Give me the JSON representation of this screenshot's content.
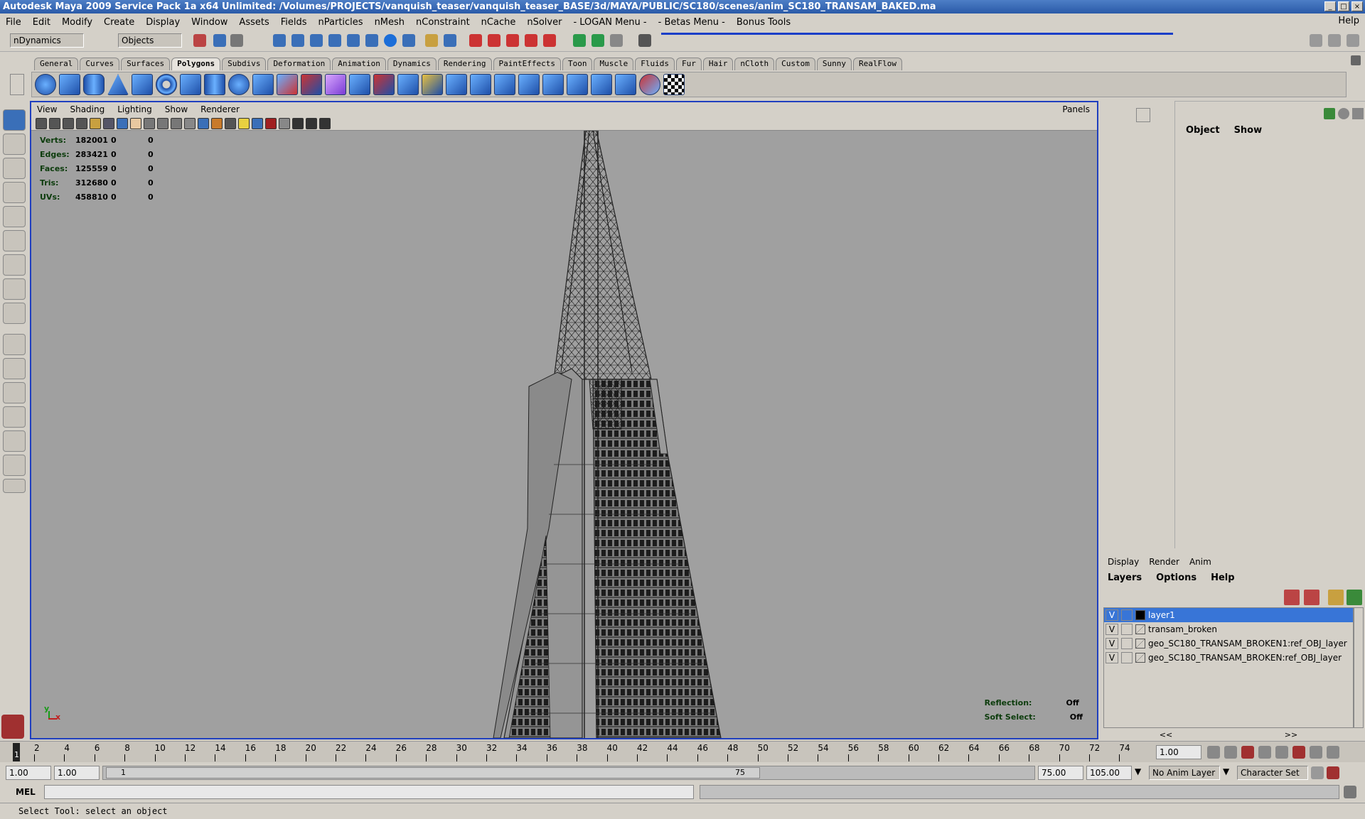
{
  "window": {
    "title": "Autodesk Maya 2009 Service Pack 1a x64 Unlimited: /Volumes/PROJECTS/vanquish_teaser/vanquish_teaser_BASE/3d/MAYA/PUBLIC/SC180/scenes/anim_SC180_TRANSAM_BAKED.ma"
  },
  "menubar": {
    "items": [
      "File",
      "Edit",
      "Modify",
      "Create",
      "Display",
      "Window",
      "Assets",
      "Fields",
      "nParticles",
      "nMesh",
      "nConstraint",
      "nCache",
      "nSolver",
      "- LOGAN Menu -",
      "- Betas Menu -",
      "Bonus Tools"
    ],
    "help": "Help"
  },
  "statusline": {
    "menuset": "nDynamics",
    "selmode": "Objects"
  },
  "shelf": {
    "tabs": [
      "General",
      "Curves",
      "Surfaces",
      "Polygons",
      "Subdivs",
      "Deformation",
      "Animation",
      "Dynamics",
      "Rendering",
      "PaintEffects",
      "Toon",
      "Muscle",
      "Fluids",
      "Fur",
      "Hair",
      "nCloth",
      "Custom",
      "Sunny",
      "RealFlow"
    ],
    "active": "Polygons"
  },
  "viewport": {
    "menu": [
      "View",
      "Shading",
      "Lighting",
      "Show",
      "Renderer"
    ],
    "panels": "Panels",
    "hud": [
      {
        "label": "Verts:",
        "v1": "182001",
        "v2": "0",
        "v3": "0"
      },
      {
        "label": "Edges:",
        "v1": "283421",
        "v2": "0",
        "v3": "0"
      },
      {
        "label": "Faces:",
        "v1": "125559",
        "v2": "0",
        "v3": "0"
      },
      {
        "label": "Tris:",
        "v1": "312680",
        "v2": "0",
        "v3": "0"
      },
      {
        "label": "UVs:",
        "v1": "458810",
        "v2": "0",
        "v3": "0"
      }
    ],
    "reflection_label": "Reflection:",
    "reflection_value": "Off",
    "softselect_label": "Soft Select:",
    "softselect_value": "Off",
    "axis_y": "y",
    "axis_x": "x"
  },
  "channelbox": {
    "tabs": [
      "Object",
      "Show"
    ]
  },
  "layers": {
    "tabs": [
      "Display",
      "Render",
      "Anim"
    ],
    "menu": [
      "Layers",
      "Options",
      "Help"
    ],
    "rows": [
      {
        "v": "V",
        "name": "layer1",
        "selected": true,
        "color": "#000000"
      },
      {
        "v": "V",
        "name": "transam_broken",
        "selected": false
      },
      {
        "v": "V",
        "name": "geo_SC180_TRANSAM_BROKEN1:ref_OBJ_layer",
        "selected": false
      },
      {
        "v": "V",
        "name": "geo_SC180_TRANSAM_BROKEN:ref_OBJ_layer",
        "selected": false
      }
    ],
    "scroll_left": "<<",
    "scroll_right": ">>"
  },
  "timeline": {
    "ticks": [
      "2",
      "4",
      "6",
      "8",
      "10",
      "12",
      "14",
      "16",
      "18",
      "20",
      "22",
      "24",
      "26",
      "28",
      "30",
      "32",
      "34",
      "36",
      "38",
      "40",
      "42",
      "44",
      "46",
      "48",
      "50",
      "52",
      "54",
      "56",
      "58",
      "60",
      "62",
      "64",
      "66",
      "68",
      "70",
      "72",
      "74"
    ],
    "current_marker": "1",
    "current_frame": "1.00"
  },
  "range": {
    "start": "1.00",
    "anim_start": "1.00",
    "slider_start": "1",
    "slider_end": "75",
    "anim_end": "75.00",
    "end": "105.00",
    "anim_layer": "No Anim Layer",
    "char_set": "Character Set"
  },
  "mel": {
    "label": "MEL"
  },
  "helpline": {
    "text": "Select Tool: select an object"
  }
}
